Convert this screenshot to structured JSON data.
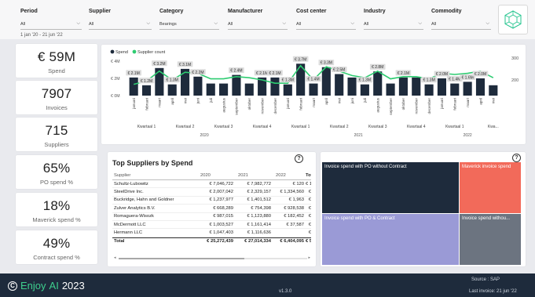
{
  "filters": [
    {
      "label": "Period",
      "value": "All"
    },
    {
      "label": "Supplier",
      "value": "All"
    },
    {
      "label": "Category",
      "value": "Bearings"
    },
    {
      "label": "Manufacturer",
      "value": "All"
    },
    {
      "label": "Cost center",
      "value": "All"
    },
    {
      "label": "Industry",
      "value": "All"
    },
    {
      "label": "Commodity",
      "value": "All"
    }
  ],
  "date_range": "1 jan '20 - 21 jun '22",
  "kpis": [
    {
      "value": "€ 59M",
      "label": "Spend"
    },
    {
      "value": "7907",
      "label": "Invoices"
    },
    {
      "value": "715",
      "label": "Suppliers"
    },
    {
      "value": "65%",
      "label": "PO spend %"
    },
    {
      "value": "18%",
      "label": "Maverick spend %"
    },
    {
      "value": "49%",
      "label": "Contract spend %"
    }
  ],
  "chart_data": {
    "type": "bar",
    "legend": [
      "Spend",
      "Supplier count"
    ],
    "y_left_ticks": [
      "€ 4M",
      "€ 2M",
      "€ 0M"
    ],
    "y_right_ticks": [
      "300",
      "200"
    ],
    "colors": {
      "spend": "#1e2b3c",
      "supplier_count": "#2ecc71"
    },
    "months": [
      "januari",
      "februari",
      "maart",
      "april",
      "mei",
      "juni",
      "juli",
      "augustus",
      "september",
      "oktober",
      "november",
      "december",
      "januari",
      "februari",
      "maart",
      "april",
      "mei",
      "juni",
      "juli",
      "augustus",
      "september",
      "oktober",
      "november",
      "december",
      "januari",
      "februari",
      "maart",
      "april",
      "mei"
    ],
    "spend_millions": [
      2.1,
      1.2,
      3.2,
      1.3,
      3.1,
      2.2,
      1.4,
      1.4,
      2.4,
      1.4,
      2.1,
      2.1,
      1.3,
      3.7,
      1.4,
      3.3,
      2.5,
      2.1,
      1.3,
      2.8,
      1.4,
      2.1,
      2.1,
      1.3,
      2.0,
      1.4,
      1.6,
      2.0,
      1.2
    ],
    "supplier_count": [
      180,
      195,
      240,
      200,
      235,
      230,
      205,
      205,
      215,
      210,
      200,
      185,
      185,
      265,
      200,
      260,
      240,
      220,
      210,
      240,
      205,
      215,
      215,
      205,
      230,
      225,
      230,
      240,
      210
    ],
    "data_labels": [
      "€ 2.1M",
      "€ 1.2M",
      "€ 3.2M",
      "€ 1.3M",
      "€ 3.1M",
      "€ 2.2M",
      "",
      "",
      "€ 2.4M",
      "",
      "€ 2.1M",
      "€ 2.1M",
      "€ 1.3M",
      "€ 3.7M",
      "€ 1.4M",
      "€ 3.3M",
      "€ 2.5M",
      "",
      "€ 1.3M",
      "€ 2.8M",
      "",
      "€ 2.1M",
      "",
      "€ 1.3M",
      "€ 2.0M",
      "€ 1.4M",
      "€ 1.6M",
      "€ 2.0M",
      ""
    ],
    "quarters": [
      "Kwartaal 1",
      "Kwartaal 2",
      "Kwartaal 3",
      "Kwartaal 4",
      "Kwartaal 1",
      "Kwartaal 2",
      "Kwartaal 3",
      "Kwartaal 4",
      "Kwartaal 1",
      "Kwa..."
    ],
    "years": [
      "2020",
      "2021",
      "2022"
    ]
  },
  "top_suppliers": {
    "title": "Top Suppliers by Spend",
    "columns": [
      "Supplier",
      "2020",
      "2021",
      "2022",
      "Tot"
    ],
    "rows": [
      [
        "Schultz-Lubowitz",
        "€ 7,046,722",
        "€ 7,982,772",
        "€ 120",
        "€ 1"
      ],
      [
        "SteelDrive Inc.",
        "€ 2,007,042",
        "€ 2,329,157",
        "€ 1,334,560",
        "€"
      ],
      [
        "Buckridge, Hahn and Goldner",
        "€ 1,237,977",
        "€ 1,401,512",
        "€ 1,963",
        "€"
      ],
      [
        "Zulver Analytics B.V.",
        "€ 668,289",
        "€ 754,398",
        "€ 928,538",
        "€"
      ],
      [
        "Romaguera-Wisozk",
        "€ 987,015",
        "€ 1,123,880",
        "€ 182,452",
        "€"
      ],
      [
        "McDermott LLC",
        "€ 1,003,527",
        "€ 1,161,414",
        "€ 37,587",
        "€"
      ],
      [
        "Hermann LLC",
        "€ 1,047,403",
        "€ 1,116,636",
        "",
        "€"
      ]
    ],
    "total": [
      "Total",
      "€ 25,272,439",
      "€ 27,014,334",
      "€ 6,404,095",
      "€ 5"
    ]
  },
  "treemap": [
    {
      "label": "Invoice spend with PO without Contract",
      "color": "#1e2b3c"
    },
    {
      "label": "Maverick invoice spend",
      "color": "#f26a5a"
    },
    {
      "label": "Invoice spend with PO & Contract",
      "color": "#9a9ad6"
    },
    {
      "label": "Invoice spend withou...",
      "color": "#6c7480"
    }
  ],
  "footer": {
    "brand_enjoy": "Enjoy",
    "brand_ai": "AI",
    "brand_year": "2023",
    "version": "v1.3.0",
    "source": "Source : SAP",
    "last_invoice": "Last invoice: 21 jun '22"
  }
}
